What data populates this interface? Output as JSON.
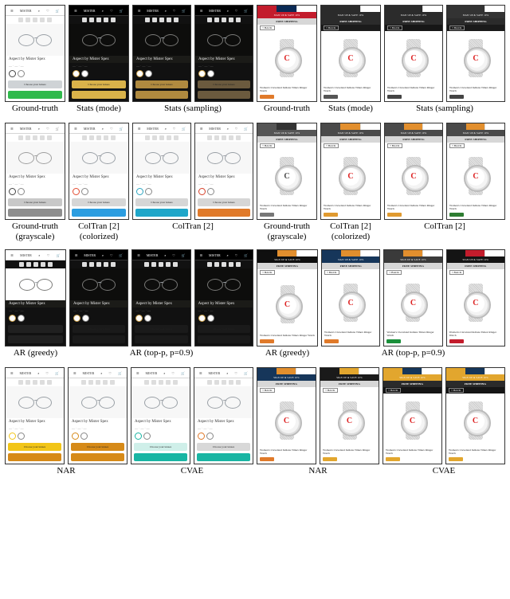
{
  "product_glasses": {
    "name": "Aspect by Mister Spex",
    "cta_choose": "Choose your lenses"
  },
  "product_watch": {
    "title": "Women's Cleveland Indians Timex Ringer Watch",
    "free_shipping": "FREE SHIPPING",
    "signup": "SIGN UP & SAVE 10%",
    "back": "< BACK"
  },
  "captions": {
    "gt": "Ground-truth",
    "stats_mode": "Stats (mode)",
    "stats_sampling": "Stats (sampling)",
    "gt_gray": "Ground-truth\n(grayscale)",
    "coltran_col": "ColTran [2]\n(colorized)",
    "coltran": "ColTran [2]",
    "ar_greedy": "AR (greedy)",
    "ar_topp": "AR (top-p, p=0.9)",
    "nar": "NAR",
    "cvae": "CVAE"
  },
  "palettes": {
    "row1": {
      "gl_gt": {
        "band": "#cfd3d6",
        "cta": "#2fb94b"
      },
      "gl_mode": {
        "band": "#d9b24a",
        "cta": "#d9b24a",
        "dark": true
      },
      "gl_samp1": {
        "band": "#b08a3f",
        "cta": "#b08a3f",
        "dark": true
      },
      "gl_samp2": {
        "band": "#6b5a3e",
        "cta": "#6b5a3e",
        "dark": true
      },
      "wt_gt": {
        "bar1": "#c31c2c",
        "bar2": "#0a2a55",
        "ban": "#c31c2c",
        "back": "#fff",
        "chip": "#e07a2a"
      },
      "wt_mode": {
        "bar1": "#2b2b2b",
        "bar2": "#2b2b2b",
        "ban": "#2b2b2b",
        "back": "#1b1b1b",
        "chip": "#555",
        "dark": true
      },
      "wt_samp1": {
        "bar1": "#2b2b2b",
        "bar2": "#2b2b2b",
        "ban": "#2b2b2b",
        "back": "#161616",
        "chip": "#444",
        "dark": true
      },
      "wt_samp2": {
        "bar1": "#333",
        "bar2": "#333",
        "ban": "#333",
        "back": "#1a1a1a",
        "chip": "#444",
        "dark": true
      }
    },
    "row2": {
      "gl_gray": {
        "band": "#c8c8c8",
        "cta": "#8e8e8e"
      },
      "gl_col": {
        "band": "#d6d6d6",
        "cta": "#2c9de0",
        "acc": "#e24a2f"
      },
      "gl_ct1": {
        "band": "#d6d6d6",
        "cta": "#1fa6c9",
        "acc": "#2aa4c0"
      },
      "gl_ct2": {
        "band": "#d6d6d6",
        "cta": "#e07a2a",
        "acc": "#d6412a"
      },
      "wt_gray": {
        "bar1": "#555",
        "bar2": "#333",
        "ban": "#555",
        "back": "#fff",
        "chip": "#777"
      },
      "wt_col": {
        "bar1": "#4a4a4a",
        "bar2": "#e28f2e",
        "ban": "#4a4a4a",
        "back": "#fff",
        "chip": "#e09a30"
      },
      "wt_ct1": {
        "bar1": "#4a4a4a",
        "bar2": "#e28f2e",
        "ban": "#4a4a4a",
        "back": "#fff",
        "chip": "#e09a30"
      },
      "wt_ct2": {
        "bar1": "#4a4a4a",
        "bar2": "#e28f2e",
        "ban": "#4a4a4a",
        "back": "#fff",
        "chip": "#2e7d32"
      }
    },
    "row3": {
      "gl_greedy": {
        "band": "#202020",
        "cta": "#202020",
        "dark": true,
        "whiteTop": true
      },
      "gl_tp1": {
        "band": "#1a1a1a",
        "cta": "#1a1a1a",
        "dark": true
      },
      "gl_tp2": {
        "band": "#1a1a1a",
        "cta": "#1a1a1a",
        "dark": true
      },
      "gl_tp3": {
        "band": "#1a1a1a",
        "cta": "#1a1a1a",
        "dark": true
      },
      "wt_greedy": {
        "bar1": "#0f0f0f",
        "bar2": "#e28f2e",
        "ban": "#0f0f0f",
        "back": "#fff",
        "chip": "#e07a2a"
      },
      "wt_tp1": {
        "bar1": "#16365a",
        "bar2": "#e28f2e",
        "ban": "#16365a",
        "back": "#fff",
        "chip": "#e07a2a"
      },
      "wt_tp2": {
        "bar1": "#3a3a3a",
        "bar2": "#e28f2e",
        "ban": "#3a3a3a",
        "back": "#fff",
        "chip": "#1a8f3a"
      },
      "wt_tp3": {
        "bar1": "#141414",
        "bar2": "#c31c2c",
        "ban": "#141414",
        "back": "#fff",
        "chip": "#c31c2c"
      }
    },
    "row4": {
      "gl_nar1": {
        "band": "#f2c517",
        "cta": "#d68a18",
        "acc": "#f2c517"
      },
      "gl_nar2": {
        "band": "#d68a18",
        "cta": "#d68a18",
        "acc": "#d68a18"
      },
      "gl_cv1": {
        "band": "#cfefe9",
        "cta": "#19b5a3",
        "acc": "#19b5a3"
      },
      "gl_cv2": {
        "band": "#d8d8d8",
        "cta": "#19b5a3",
        "acc": "#e07a2a"
      },
      "wt_nar1": {
        "bar1": "#16365a",
        "bar2": "#e28f2e",
        "ban": "#16365a",
        "back": "#fff",
        "chip": "#e07a2a"
      },
      "wt_nar2": {
        "bar1": "#1a1a1a",
        "bar2": "#e2a62e",
        "ban": "#1a1a1a",
        "back": "#fff",
        "chip": "#e2a62e"
      },
      "wt_cv1": {
        "bar1": "#e2a62e",
        "bar2": "#16365a",
        "ban": "#e2a62e",
        "back": "#151515",
        "chip": "#e2a62e",
        "dark": true
      },
      "wt_cv2": {
        "bar1": "#e2a62e",
        "bar2": "#16365a",
        "ban": "#e2a62e",
        "back": "#151515",
        "chip": "#e2a62e",
        "dark": true
      }
    }
  }
}
